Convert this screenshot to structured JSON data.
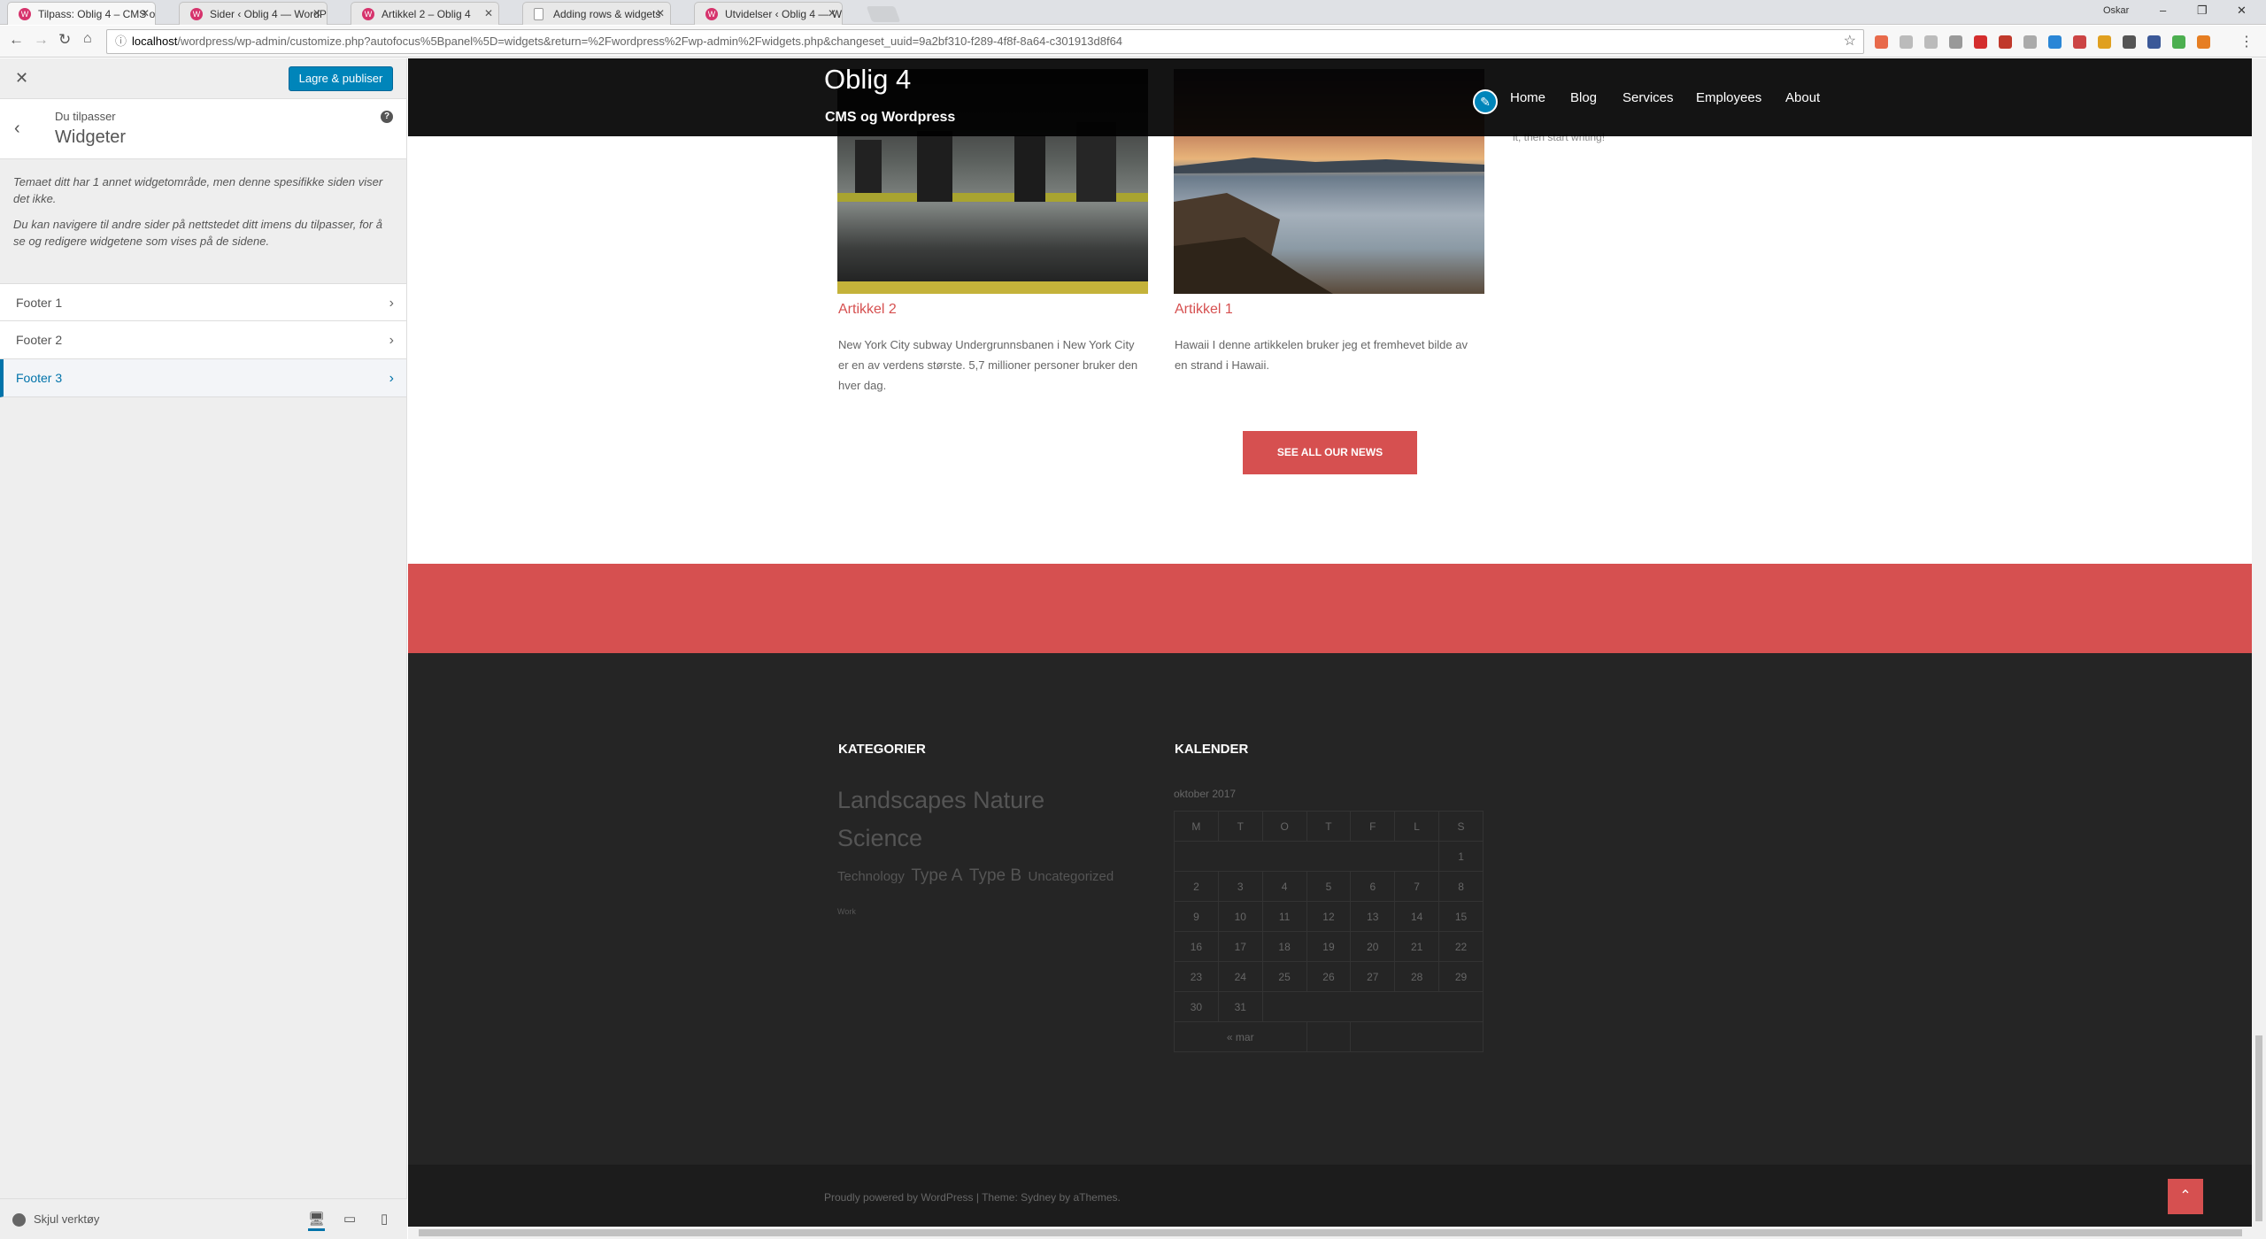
{
  "browser": {
    "tabs": [
      {
        "title": "Tilpass: Oblig 4 – CMS o"
      },
      {
        "title": "Sider ‹ Oblig 4 — WordP"
      },
      {
        "title": "Artikkel 2 – Oblig 4"
      },
      {
        "title": "Adding rows & widgets"
      },
      {
        "title": "Utvidelser ‹ Oblig 4 — W"
      }
    ],
    "profile": "Oskar",
    "url_host": "localhost",
    "url_path": "/wordpress/wp-admin/customize.php?autofocus%5Bpanel%5D=widgets&return=%2Fwordpress%2Fwp-admin%2Fwidgets.php&changeset_uuid=9a2bf310-f289-4f8f-8a64-c301913d8f64"
  },
  "customizer": {
    "publish_label": "Lagre & publiser",
    "customizing_label": "Du tilpasser",
    "section_title": "Widgeter",
    "desc1": "Temaet ditt har 1 annet widgetområde, men denne spesifikke siden viser det ikke.",
    "desc2": "Du kan navigere til andre sider på nettstedet ditt imens du tilpasser, for å se og redigere widgetene som vises på de sidene.",
    "areas": [
      "Footer 1",
      "Footer 2",
      "Footer 3"
    ],
    "hide_controls": "Skjul verktøy"
  },
  "site": {
    "title": "Oblig 4",
    "tagline": "CMS og Wordpress",
    "nav": [
      "Home",
      "Blog",
      "Services",
      "Employees",
      "About"
    ],
    "cut_text": "it, then start writing!",
    "articles": [
      {
        "title": "Artikkel 2",
        "excerpt": "New York City subway   Undergrunnsbanen i New York City er en av verdens største. 5,7 millioner personer bruker den hver dag."
      },
      {
        "title": "Artikkel 1",
        "excerpt": "Hawaii I denne artikkelen bruker jeg et fremhevet bilde av en strand i Hawaii."
      }
    ],
    "news_button": "SEE ALL OUR NEWS",
    "categories_title": "KATEGORIER",
    "tags": [
      "Landscapes",
      "Nature",
      "Science",
      "Technology",
      "Type A",
      "Type B",
      "Uncategorized",
      "Work"
    ],
    "calendar_title": "KALENDER",
    "calendar": {
      "caption": "oktober 2017",
      "days": [
        "M",
        "T",
        "O",
        "T",
        "F",
        "L",
        "S"
      ],
      "prev": "« mar"
    },
    "credits": "Proudly powered by WordPress | Theme: Sydney by aThemes."
  },
  "colors": {
    "accent": "#d65050",
    "wp_blue": "#0085ba",
    "footer_dark": "#252525"
  }
}
